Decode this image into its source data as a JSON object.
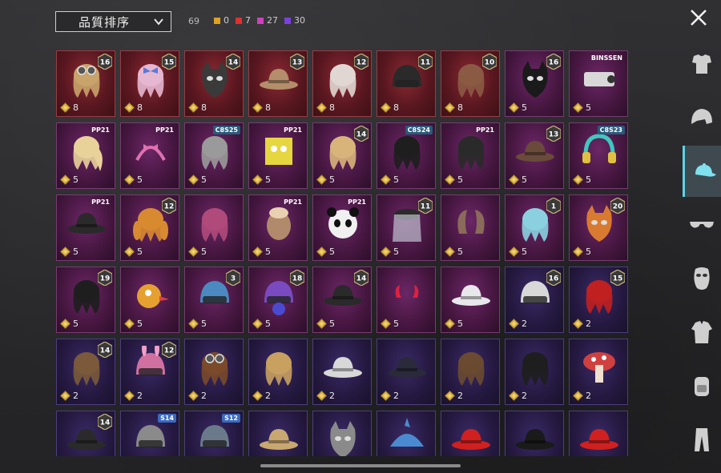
{
  "toolbar": {
    "sort_label": "品質排序",
    "total_count": "69",
    "rarity_counts": [
      {
        "value": "0",
        "color": "#e0a020"
      },
      {
        "value": "7",
        "color": "#e03030"
      },
      {
        "value": "27",
        "color": "#d040c0"
      },
      {
        "value": "30",
        "color": "#7a40e0"
      }
    ]
  },
  "sidebar": {
    "items": [
      {
        "name": "outfit-icon",
        "active": false
      },
      {
        "name": "helmet-icon",
        "active": false
      },
      {
        "name": "cap-icon",
        "active": true
      },
      {
        "name": "sunglasses-icon",
        "active": false
      },
      {
        "name": "mask-icon",
        "active": false
      },
      {
        "name": "jacket-icon",
        "active": false
      },
      {
        "name": "backpack-icon",
        "active": false
      },
      {
        "name": "pants-icon",
        "active": false
      }
    ]
  },
  "items": [
    {
      "rarity": "red",
      "price": "8",
      "level": "16",
      "art": "goggle-hair",
      "color": "#c8a36a"
    },
    {
      "rarity": "red",
      "price": "8",
      "level": "15",
      "art": "bow-hair",
      "color": "#e6b7d0"
    },
    {
      "rarity": "red",
      "price": "8",
      "level": "14",
      "art": "cat-mask",
      "color": "#3a3a3a"
    },
    {
      "rarity": "red",
      "price": "8",
      "level": "13",
      "art": "hat-hair",
      "color": "#b48d6a"
    },
    {
      "rarity": "red",
      "price": "8",
      "level": "12",
      "art": "long-hair",
      "color": "#e0d7d2"
    },
    {
      "rarity": "red",
      "price": "8",
      "level": "11",
      "art": "helmet",
      "color": "#2a2a2a"
    },
    {
      "rarity": "red",
      "price": "8",
      "level": "10",
      "art": "hair",
      "color": "#8a5a44"
    },
    {
      "rarity": "pink",
      "price": "5",
      "level": "16",
      "art": "hood",
      "color": "#1a1a1a"
    },
    {
      "rarity": "pink",
      "price": "5",
      "season": "BINSSEN",
      "art": "camera",
      "color": "#d8d8d8"
    },
    {
      "rarity": "pink",
      "price": "5",
      "season": "PP21",
      "art": "ponytail",
      "color": "#e8d29a"
    },
    {
      "rarity": "pink",
      "price": "5",
      "season": "PP21",
      "art": "headband",
      "color": "#e070b0"
    },
    {
      "rarity": "pink",
      "price": "5",
      "season": "C8S25",
      "art": "hair",
      "color": "#9a9a9a"
    },
    {
      "rarity": "pink",
      "price": "5",
      "season": "PP21",
      "art": "box-head",
      "color": "#e6d640"
    },
    {
      "rarity": "pink",
      "price": "5",
      "level": "14",
      "art": "hair",
      "color": "#d8b47a"
    },
    {
      "rarity": "pink",
      "price": "5",
      "season": "C8S24",
      "art": "hair",
      "color": "#1e1e1e"
    },
    {
      "rarity": "pink",
      "price": "5",
      "season": "PP21",
      "art": "hair",
      "color": "#2a2a2a"
    },
    {
      "rarity": "pink",
      "price": "5",
      "level": "13",
      "art": "beret",
      "color": "#6a4a3a"
    },
    {
      "rarity": "pink",
      "price": "5",
      "season": "C8S23",
      "art": "headphones",
      "color": "#3ec8c0"
    },
    {
      "rarity": "pink",
      "price": "5",
      "season": "PP21",
      "art": "cap",
      "color": "#2a2a2a"
    },
    {
      "rarity": "pink",
      "price": "5",
      "level": "12",
      "art": "twin-tails",
      "color": "#d88a30"
    },
    {
      "rarity": "pink",
      "price": "5",
      "art": "hair",
      "color": "#b04a7a"
    },
    {
      "rarity": "pink",
      "price": "5",
      "season": "PP21",
      "art": "alpaca",
      "color": "#b08a6a"
    },
    {
      "rarity": "pink",
      "price": "5",
      "season": "PP21",
      "art": "panda",
      "color": "#f0f0f0"
    },
    {
      "rarity": "pink",
      "price": "5",
      "level": "11",
      "art": "veil",
      "color": "#c0c0d0"
    },
    {
      "rarity": "pink",
      "price": "5",
      "art": "horns",
      "color": "#8a6a5a"
    },
    {
      "rarity": "pink",
      "price": "5",
      "level": "1",
      "art": "hair",
      "color": "#8ad0e0"
    },
    {
      "rarity": "pink",
      "price": "5",
      "level": "20",
      "art": "mask",
      "color": "#d87a30"
    },
    {
      "rarity": "pink",
      "price": "5",
      "level": "19",
      "art": "hair",
      "color": "#1e1e1e"
    },
    {
      "rarity": "pink",
      "price": "5",
      "art": "bird-head",
      "color": "#e6a030"
    },
    {
      "rarity": "pink",
      "price": "5",
      "level": "3",
      "art": "robot-helmet",
      "color": "#4a8ac0"
    },
    {
      "rarity": "pink",
      "price": "5",
      "level": "18",
      "art": "space-helmet",
      "color": "#7a4ac0"
    },
    {
      "rarity": "pink",
      "price": "5",
      "level": "14",
      "art": "officer-cap",
      "color": "#2a2a2a"
    },
    {
      "rarity": "pink",
      "price": "5",
      "art": "devil-horns",
      "color": "#e02040"
    },
    {
      "rarity": "pink",
      "price": "5",
      "art": "bucket-hat",
      "color": "#e8e8ec"
    },
    {
      "rarity": "purple",
      "price": "2",
      "level": "16",
      "art": "helmet",
      "color": "#d8d8d8"
    },
    {
      "rarity": "purple",
      "price": "2",
      "level": "15",
      "art": "hair",
      "color": "#c02020"
    },
    {
      "rarity": "purple",
      "price": "2",
      "level": "14",
      "art": "hair",
      "color": "#7a5a3a"
    },
    {
      "rarity": "purple",
      "price": "2",
      "level": "12",
      "art": "bunny-helmet",
      "color": "#d070a0"
    },
    {
      "rarity": "purple",
      "price": "2",
      "art": "goggle-hair",
      "color": "#7a4a2a"
    },
    {
      "rarity": "purple",
      "price": "2",
      "art": "hair",
      "color": "#c8a060"
    },
    {
      "rarity": "purple",
      "price": "2",
      "art": "wide-hat",
      "color": "#d8d8d8"
    },
    {
      "rarity": "purple",
      "price": "2",
      "art": "beanie",
      "color": "#2a2a3a"
    },
    {
      "rarity": "purple",
      "price": "2",
      "art": "hair",
      "color": "#6a4a30"
    },
    {
      "rarity": "purple",
      "price": "2",
      "art": "hair",
      "color": "#1e1e1e"
    },
    {
      "rarity": "purple",
      "price": "2",
      "art": "mushroom",
      "color": "#d04040"
    },
    {
      "rarity": "purple",
      "price": "",
      "level": "14",
      "art": "officer-cap",
      "color": "#2a2a2a"
    },
    {
      "rarity": "purple",
      "price": "",
      "season": "S14",
      "art": "knight-helmet",
      "color": "#8a8a8a"
    },
    {
      "rarity": "purple",
      "price": "",
      "season": "S12",
      "art": "moto-helmet",
      "color": "#6a7a8a"
    },
    {
      "rarity": "purple",
      "price": "",
      "art": "straw-hat",
      "color": "#c8a870"
    },
    {
      "rarity": "purple",
      "price": "",
      "art": "ski-mask",
      "color": "#8a8a8a"
    },
    {
      "rarity": "purple",
      "price": "",
      "art": "shark",
      "color": "#4a8ad0"
    },
    {
      "rarity": "purple",
      "price": "",
      "art": "beret",
      "color": "#d02020"
    },
    {
      "rarity": "purple",
      "price": "",
      "art": "bowler",
      "color": "#1a1a1a"
    },
    {
      "rarity": "purple",
      "price": "",
      "art": "fedora",
      "color": "#d02020"
    }
  ]
}
